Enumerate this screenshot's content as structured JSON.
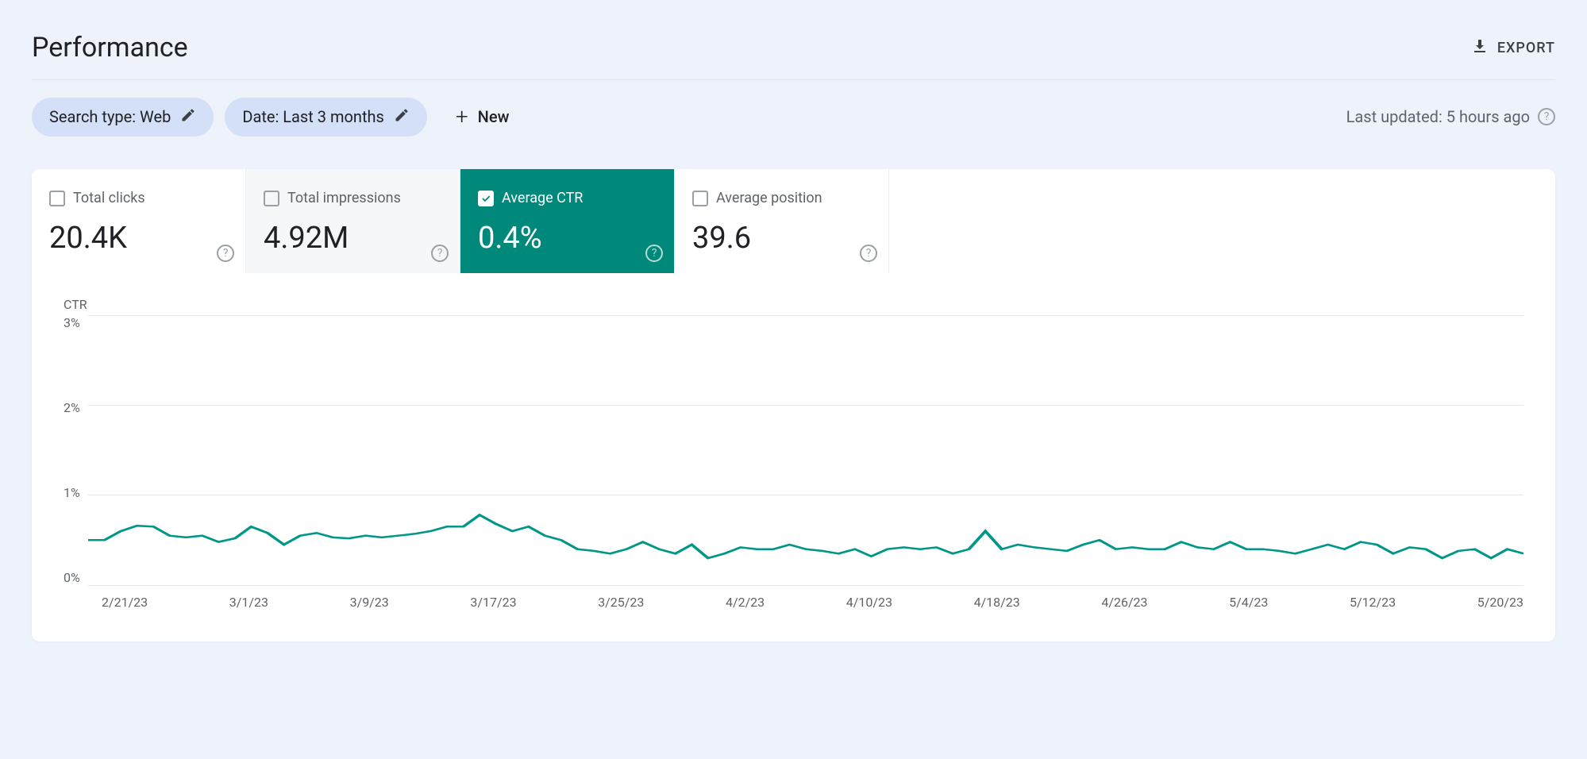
{
  "header": {
    "title": "Performance",
    "export": "EXPORT"
  },
  "filters": {
    "search_type": "Search type: Web",
    "date": "Date: Last 3 months",
    "new": "New"
  },
  "last_updated": "Last updated: 5 hours ago",
  "metrics": {
    "clicks": {
      "label": "Total clicks",
      "value": "20.4K"
    },
    "impressions": {
      "label": "Total impressions",
      "value": "4.92M"
    },
    "ctr": {
      "label": "Average CTR",
      "value": "0.4%"
    },
    "position": {
      "label": "Average position",
      "value": "39.6"
    }
  },
  "chart": {
    "axis_title": "CTR",
    "y_ticks": [
      "3%",
      "2%",
      "1%",
      "0%"
    ],
    "x_ticks": [
      "2/21/23",
      "3/1/23",
      "3/9/23",
      "3/17/23",
      "3/25/23",
      "4/2/23",
      "4/10/23",
      "4/18/23",
      "4/26/23",
      "5/4/23",
      "5/12/23",
      "5/20/23"
    ]
  },
  "chart_data": {
    "type": "line",
    "title": "CTR",
    "xlabel": "",
    "ylabel": "CTR",
    "ylim": [
      0,
      3
    ],
    "x": [
      "2/21/23",
      "2/22/23",
      "2/23/23",
      "2/24/23",
      "2/25/23",
      "2/26/23",
      "2/27/23",
      "2/28/23",
      "3/1/23",
      "3/2/23",
      "3/3/23",
      "3/4/23",
      "3/5/23",
      "3/6/23",
      "3/7/23",
      "3/8/23",
      "3/9/23",
      "3/10/23",
      "3/11/23",
      "3/12/23",
      "3/13/23",
      "3/14/23",
      "3/15/23",
      "3/16/23",
      "3/17/23",
      "3/18/23",
      "3/19/23",
      "3/20/23",
      "3/21/23",
      "3/22/23",
      "3/23/23",
      "3/24/23",
      "3/25/23",
      "3/26/23",
      "3/27/23",
      "3/28/23",
      "3/29/23",
      "3/30/23",
      "3/31/23",
      "4/1/23",
      "4/2/23",
      "4/3/23",
      "4/4/23",
      "4/5/23",
      "4/6/23",
      "4/7/23",
      "4/8/23",
      "4/9/23",
      "4/10/23",
      "4/11/23",
      "4/12/23",
      "4/13/23",
      "4/14/23",
      "4/15/23",
      "4/16/23",
      "4/17/23",
      "4/18/23",
      "4/19/23",
      "4/20/23",
      "4/21/23",
      "4/22/23",
      "4/23/23",
      "4/24/23",
      "4/25/23",
      "4/26/23",
      "4/27/23",
      "4/28/23",
      "4/29/23",
      "4/30/23",
      "5/1/23",
      "5/2/23",
      "5/3/23",
      "5/4/23",
      "5/5/23",
      "5/6/23",
      "5/7/23",
      "5/8/23",
      "5/9/23",
      "5/10/23",
      "5/11/23",
      "5/12/23",
      "5/13/23",
      "5/14/23",
      "5/15/23",
      "5/16/23",
      "5/17/23",
      "5/18/23",
      "5/19/23",
      "5/20/23"
    ],
    "series": [
      {
        "name": "Average CTR (%)",
        "values": [
          0.5,
          0.5,
          0.6,
          0.66,
          0.65,
          0.55,
          0.53,
          0.55,
          0.48,
          0.52,
          0.65,
          0.58,
          0.45,
          0.55,
          0.58,
          0.53,
          0.52,
          0.55,
          0.53,
          0.55,
          0.57,
          0.6,
          0.65,
          0.65,
          0.78,
          0.68,
          0.6,
          0.65,
          0.55,
          0.5,
          0.4,
          0.38,
          0.35,
          0.4,
          0.48,
          0.4,
          0.35,
          0.45,
          0.3,
          0.35,
          0.42,
          0.4,
          0.4,
          0.45,
          0.4,
          0.38,
          0.35,
          0.4,
          0.32,
          0.4,
          0.42,
          0.4,
          0.42,
          0.35,
          0.4,
          0.6,
          0.4,
          0.45,
          0.42,
          0.4,
          0.38,
          0.45,
          0.5,
          0.4,
          0.42,
          0.4,
          0.4,
          0.48,
          0.42,
          0.4,
          0.48,
          0.4,
          0.4,
          0.38,
          0.35,
          0.4,
          0.45,
          0.4,
          0.48,
          0.45,
          0.35,
          0.42,
          0.4,
          0.3,
          0.38,
          0.4,
          0.3,
          0.4,
          0.35
        ]
      }
    ]
  }
}
